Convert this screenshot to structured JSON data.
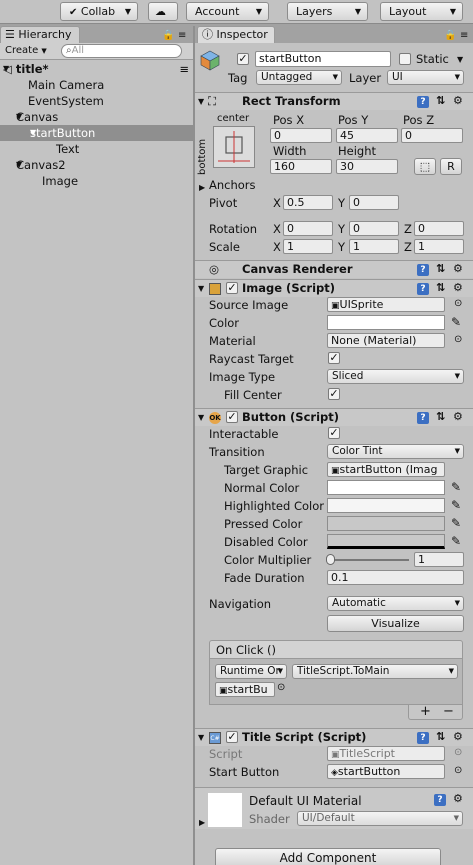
{
  "toolbar": {
    "collab": "Collab",
    "account": "Account",
    "layers": "Layers",
    "layout": "Layout"
  },
  "hierarchy": {
    "tab": "Hierarchy",
    "create": "Create",
    "search_placeholder": "All",
    "scene": "title*",
    "items": [
      "Main Camera",
      "EventSystem",
      "Canvas",
      "startButton",
      "Text",
      "Canvas2",
      "Image"
    ]
  },
  "inspector": {
    "tab": "Inspector",
    "object_name": "startButton",
    "static_label": "Static",
    "tag_label": "Tag",
    "tag_value": "Untagged",
    "layer_label": "Layer",
    "layer_value": "UI",
    "rect_transform": {
      "title": "Rect Transform",
      "anchor_h": "center",
      "anchor_v": "bottom",
      "posx_label": "Pos X",
      "posy_label": "Pos Y",
      "posz_label": "Pos Z",
      "posx": "0",
      "posy": "45",
      "posz": "0",
      "width_label": "Width",
      "height_label": "Height",
      "width": "160",
      "height": "30",
      "raw_button": "R",
      "anchors_label": "Anchors",
      "pivot_label": "Pivot",
      "pivot_x": "0.5",
      "pivot_y": "0",
      "rotation_label": "Rotation",
      "rot_x": "0",
      "rot_y": "0",
      "rot_z": "0",
      "scale_label": "Scale",
      "scale_x": "1",
      "scale_y": "1",
      "scale_z": "1",
      "x": "X",
      "y": "Y",
      "z": "Z"
    },
    "canvas_renderer": {
      "title": "Canvas Renderer"
    },
    "image": {
      "title": "Image (Script)",
      "source_image_label": "Source Image",
      "source_image": "UISprite",
      "color_label": "Color",
      "material_label": "Material",
      "material": "None (Material)",
      "raycast_label": "Raycast Target",
      "image_type_label": "Image Type",
      "image_type": "Sliced",
      "fill_center_label": "Fill Center"
    },
    "button": {
      "title": "Button (Script)",
      "interactable_label": "Interactable",
      "transition_label": "Transition",
      "transition": "Color Tint",
      "target_graphic_label": "Target Graphic",
      "target_graphic": "startButton (Imag",
      "normal_label": "Normal Color",
      "highlighted_label": "Highlighted Color",
      "pressed_label": "Pressed Color",
      "disabled_label": "Disabled Color",
      "multiplier_label": "Color Multiplier",
      "multiplier": "1",
      "fade_label": "Fade Duration",
      "fade": "0.1",
      "navigation_label": "Navigation",
      "navigation": "Automatic",
      "visualize": "Visualize",
      "onclick_title": "On Click ()",
      "runtime": "Runtime Or",
      "function": "TitleScript.ToMain",
      "target_obj": "startBu",
      "add": "+",
      "remove": "−"
    },
    "title_script": {
      "title": "Title Script (Script)",
      "script_label": "Script",
      "script": "TitleScript",
      "start_button_label": "Start Button",
      "start_button": "startButton"
    },
    "material": {
      "name": "Default UI Material",
      "shader_label": "Shader",
      "shader": "UI/Default"
    },
    "add_component": "Add Component"
  },
  "colors": {
    "panel_bg": "#c2c2c2",
    "selection": "#8f8f8f",
    "check_blue": "#3c6fc2"
  }
}
